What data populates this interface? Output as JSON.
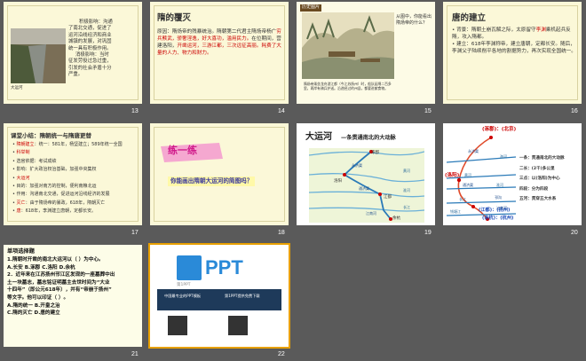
{
  "slides": [
    {
      "number": "13",
      "body_lines": [
        "积极影响：沟通",
        "了南北交通，促进了",
        "运河沿线经济和商业",
        "城镇的发展，对巩固",
        "统一具有积极作用。",
        "消极影响：当时",
        "征发劳役过急过重，",
        "引发的社会矛盾十分",
        "严重。"
      ],
      "photo_caption": "大运河"
    },
    {
      "number": "14",
      "title": "隋的覆灭",
      "line1": "原因：隋炀帝的残暴统治。隋朝第二代君主隋炀帝杨广",
      "hl1": "穷兵黩武，骄奢淫逸，好大喜功，滥用民力。",
      "line2": "在位期间，营建洛阳，",
      "hl2": "开凿运河，三游江都，三次远征高丽。耗费了大量的人力、物力和财力。"
    },
    {
      "number": "15",
      "stamp": "历史图片",
      "side_text": "从图中，你能看出隋炀帝的什么？",
      "caption": "隋炀帝乘坐龙舟游江都（今江苏扬州）时，船队延绵二百多里，两岸有骑兵护送。沿途经过的州县，都要进献食物。"
    },
    {
      "number": "16",
      "title": "唐的建立",
      "b1a": "背景：隋朝土崩瓦解之际，太原留守",
      "b1b": "李渊",
      "b1c": "乘机起兵反隋，攻入隋都。",
      "b2": "建立：618年李渊称帝，建立唐朝，定都长安。随后，李渊父子陆续削平各地的割据势力，再次实现全国统一。"
    },
    {
      "number": "17",
      "title": "课堂小结：隋朝统一与隋唐更替",
      "rows": [
        {
          "label": "隋朝建立",
          "text": "：统一：581年，杨坚建立；589年统一全国"
        },
        {
          "label": "科举制",
          "text": ""
        },
        {
          "label": "",
          "text": "选官依据：考试成绩"
        },
        {
          "label": "",
          "text": "影响：扩大政治权治基础，加强中央集权"
        },
        {
          "label": "大运河",
          "text": ""
        },
        {
          "label": "",
          "text": "目的：加强对南方的控制，便利南粮北运"
        },
        {
          "label": "",
          "text": "作用：沟通南北交通，促进运河沿线经济的发展"
        },
        {
          "label": "灭亡",
          "text": "：由于隋炀帝的暴政，618年，隋朝灭亡"
        },
        {
          "label": "唐",
          "text": "：618年，李渊建立唐朝，定都长安。"
        }
      ]
    },
    {
      "number": "18",
      "practice": "练一练",
      "question": "你能画出隋朝大运河的简图吗？"
    },
    {
      "number": "19",
      "title": "大运河",
      "subtitle": "—条贯通南北的大动脉",
      "places": [
        "涿郡",
        "洛阳",
        "余杭",
        "江都",
        "黄河",
        "淮河",
        "长江",
        "永济渠",
        "通济渠",
        "江南河"
      ]
    },
    {
      "number": "20",
      "top": "(涿郡)：(北京)",
      "mid": "(洛阳)",
      "bottom1": "(江都)：(扬州)",
      "bottom2": "(余杭)：(杭州)",
      "rivers": [
        "永济渠",
        "海河",
        "黄河",
        "通济渠",
        "淮河",
        "邗沟",
        "长江",
        "江南河",
        "钱塘江"
      ],
      "points": [
        "一条：贯通南北的大动脉",
        "二长：(2千)多公里",
        "三点：以(洛阳)为中心",
        "四段：分为四段",
        "五河：贯穿五大水系"
      ]
    },
    {
      "number": "21",
      "heading": "单项选择题",
      "lines": [
        "1.隋朝时开凿的南北大运河以（    ）为中心。",
        "A.长安      B.涿郡      C.洛阳      D.余杭",
        "2．近年来在江苏扬州邗江区发现的一座墓葬中出",
        "土一块墓志，墓志铭证明墓主去世时间为“大业",
        "十四年”（即公元618年），并有“帝崩于扬州”",
        "等文字。他可以印证（    ）。",
        "A.隋的统一           B.开皇之治",
        "C.隋的灭亡           D.唐的建立"
      ]
    },
    {
      "number": "22",
      "logo_word": "PPT",
      "logo_sub": "第1PPT",
      "col1": "中国最专业的PPT模板",
      "col2": "第1PPT提供免费下载"
    }
  ],
  "colors": {
    "red": "#cc0000",
    "blue": "#1a58b8",
    "magenta": "#cc00aa",
    "green": "#119955",
    "slide_bg": "#fbf8d8",
    "background": "#5a5a5a"
  }
}
